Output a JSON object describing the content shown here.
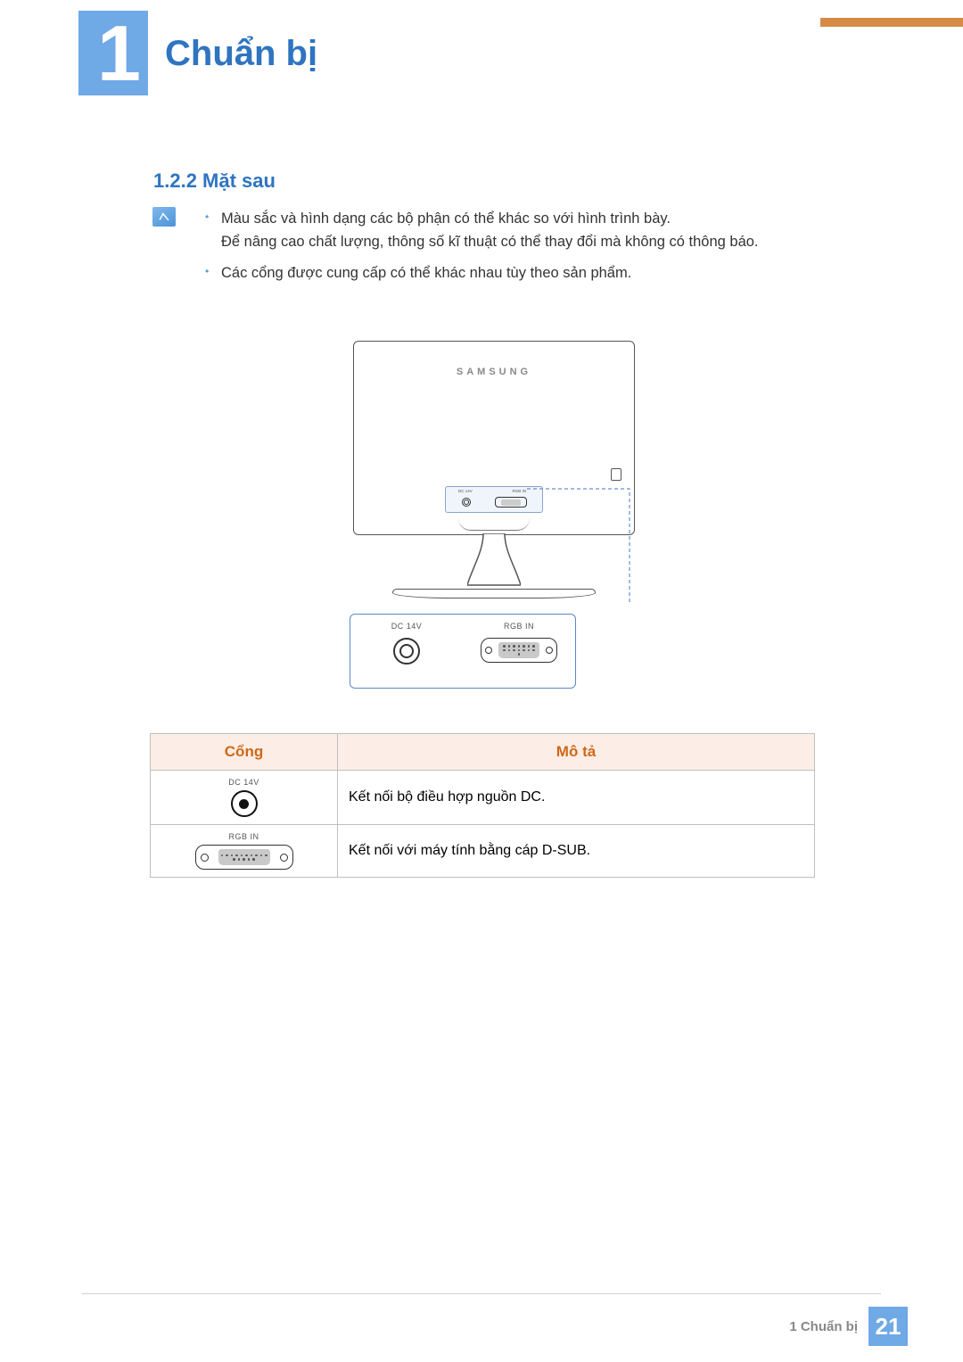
{
  "header": {
    "chapter_number": "1",
    "chapter_title": "Chuẩn bị"
  },
  "section": {
    "number_and_title": "1.2.2  Mặt sau"
  },
  "notes": {
    "items": [
      "Màu sắc và hình dạng các bộ phận có thể khác so với hình trình bày.\nĐể nâng cao chất lượng, thông số kĩ thuật có thể thay đổi mà không có thông báo.",
      "Các cổng được cung cấp có thể khác nhau tùy theo sản phẩm."
    ]
  },
  "diagram": {
    "brand": "SAMSUNG",
    "port_labels": {
      "dc": "DC 14V",
      "rgb": "RGB IN"
    }
  },
  "table": {
    "headers": {
      "port": "Cổng",
      "desc": "Mô tả"
    },
    "rows": [
      {
        "port_label": "DC 14V",
        "port_kind": "dc",
        "desc": "Kết nối bộ điều hợp nguồn DC."
      },
      {
        "port_label": "RGB IN",
        "port_kind": "vga",
        "desc": "Kết nối với máy tính bằng cáp D-SUB."
      }
    ]
  },
  "footer": {
    "chapter_ref": "1 Chuẩn bị",
    "page_number": "21"
  }
}
